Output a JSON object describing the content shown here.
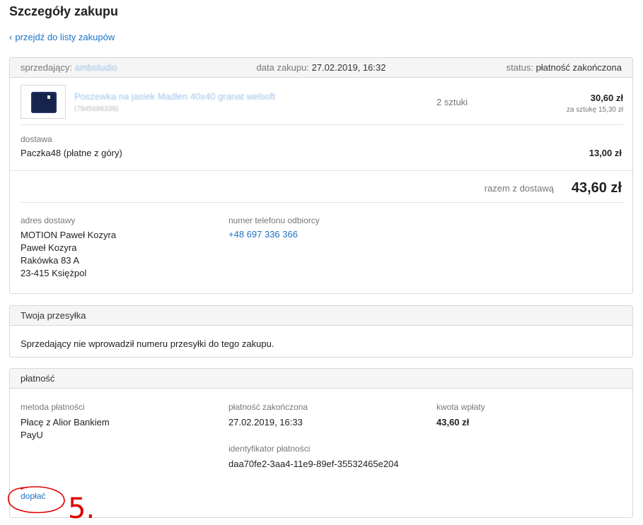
{
  "page": {
    "title": "Szczegóły zakupu",
    "back_link": "przejdź do listy zakupów"
  },
  "order": {
    "seller_label": "sprzedający:",
    "seller_name": "ambstudio",
    "date_label": "data zakupu:",
    "date_value": "27.02.2019, 16:32",
    "status_label": "status:",
    "status_value": "płatność zakończona",
    "product": {
      "name": "Poszewka na jasiek Madlen 40x40 granat welsoft",
      "id": "(7845686339)",
      "quantity": "2 sztuki",
      "price": "30,60 zł",
      "unit_price": "za sztukę 15,30 zł"
    },
    "shipping_label": "dostawa",
    "shipping_name": "Paczka48 (płatne z góry)",
    "shipping_price": "13,00 zł",
    "total_label": "razem z dostawą",
    "total_value": "43,60 zł",
    "address_label": "adres dostawy",
    "address_lines": [
      "MOTION Paweł Kozyra",
      "Paweł Kozyra",
      "Rakówka 83 A",
      "23-415 Księżpol"
    ],
    "phone_label": "numer telefonu odbiorcy",
    "phone_value": "+48 697 336 366"
  },
  "shipment": {
    "title": "Twoja przesyłka",
    "message": "Sprzedający nie wprowadził numeru przesyłki do tego zakupu."
  },
  "payment": {
    "title": "płatność",
    "method_label": "metoda płatności",
    "method_lines": [
      "Płacę z Alior Bankiem",
      "PayU"
    ],
    "done_label": "płatność zakończona",
    "done_value": "27.02.2019, 16:33",
    "amount_label": "kwota wpłaty",
    "amount_value": "43,60 zł",
    "id_label": "identyfikator płatności",
    "id_value": "daa70fe2-3aa4-11e9-89ef-35532465e204",
    "pay_more_link": "dopłać"
  },
  "annotation": {
    "number": "5.",
    "color": "#e00000"
  },
  "colors": {
    "link": "#1a73c7",
    "header_bg": "#f5f5f5",
    "border": "#d8d8d8"
  }
}
